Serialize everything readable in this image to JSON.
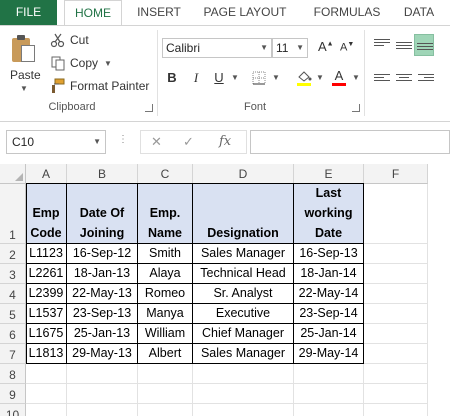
{
  "ribbon_tabs": {
    "file": "FILE",
    "home": "HOME",
    "insert": "INSERT",
    "page_layout": "PAGE LAYOUT",
    "formulas": "FORMULAS",
    "data": "DATA"
  },
  "clipboard": {
    "paste_label": "Paste",
    "cut_label": "Cut",
    "copy_label": "Copy",
    "format_painter_label": "Format Painter",
    "group_label": "Clipboard"
  },
  "font_group": {
    "font_name": "Calibri",
    "font_size": "11",
    "group_label": "Font",
    "bold": "B",
    "italic": "I",
    "underline": "U",
    "grow_font": "A",
    "shrink_font": "A",
    "font_color_letter": "A",
    "fill_color": "#ffff00",
    "font_color": "#ff0000"
  },
  "formula_bar": {
    "name_box": "C10",
    "cancel_icon": "✕",
    "enter_icon": "✓",
    "fx_label": "fx",
    "formula_value": ""
  },
  "sheet": {
    "columns": [
      "A",
      "B",
      "C",
      "D",
      "E",
      "F"
    ],
    "rows": [
      "1",
      "2",
      "3",
      "4",
      "5",
      "6",
      "7",
      "8",
      "9",
      "10"
    ],
    "header_row": [
      "Emp Code",
      "Date Of Joining",
      "Emp. Name",
      "Designation",
      "Last working Date"
    ],
    "data_rows": [
      [
        "L1123",
        "16-Sep-12",
        "Smith",
        "Sales Manager",
        "16-Sep-13"
      ],
      [
        "L2261",
        "18-Jan-13",
        "Alaya",
        "Technical Head",
        "18-Jan-14"
      ],
      [
        "L2399",
        "22-May-13",
        "Romeo",
        "Sr. Analyst",
        "22-May-14"
      ],
      [
        "L1537",
        "23-Sep-13",
        "Manya",
        "Executive",
        "23-Sep-14"
      ],
      [
        "L1675",
        "25-Jan-13",
        "William",
        "Chief Manager",
        "25-Jan-14"
      ],
      [
        "L1813",
        "29-May-13",
        "Albert",
        "Sales Manager",
        "29-May-14"
      ]
    ],
    "header_fill": "#d9e1f2",
    "accent": "#217346"
  }
}
